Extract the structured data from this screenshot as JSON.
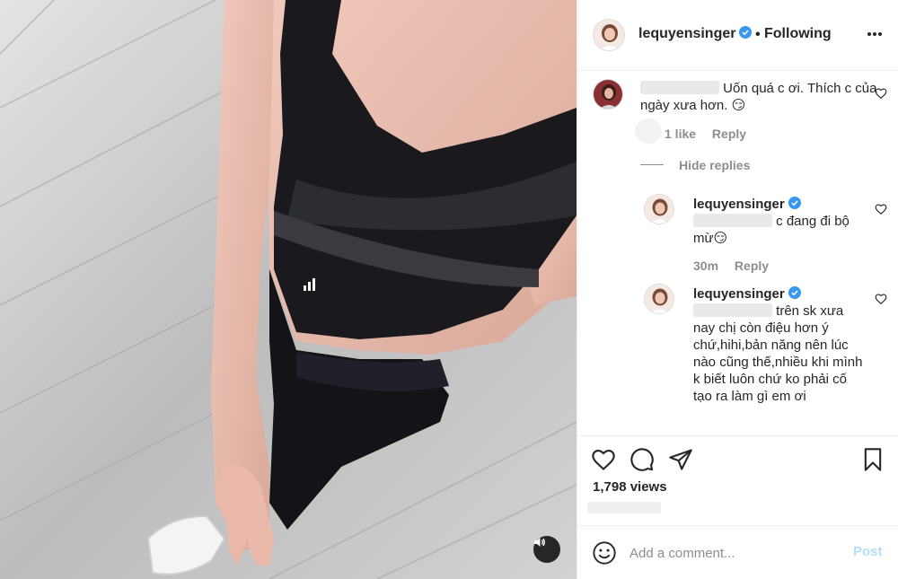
{
  "post": {
    "author": "lequyensinger",
    "verified": true,
    "follow_status": "Following",
    "separator": "•"
  },
  "comments": [
    {
      "id": "c1",
      "username": "",
      "text": "Uốn quá c ơi. Thích c của ngày xưa hơn. 😏",
      "likes_text": "1 like",
      "reply_label": "Reply",
      "hide_replies_label": "Hide replies",
      "replies": [
        {
          "id": "r1",
          "username": "lequyensinger",
          "verified": true,
          "text": "c đang đi bộ mừ😏",
          "time": "30m",
          "reply_label": "Reply"
        },
        {
          "id": "r2",
          "username": "lequyensinger",
          "verified": true,
          "text": "trên sk xưa nay chị còn điệu hơn ý chứ,hihi,bản năng nên lúc nào cũng thế,nhiều khi mình k biết luôn chứ ko phải cố tạo ra làm gì em ơi"
        }
      ]
    }
  ],
  "actions": {
    "like_icon": "heart-icon",
    "comment_icon": "comment-icon",
    "share_icon": "share-icon",
    "save_icon": "bookmark-icon"
  },
  "views_text": "1,798 views",
  "add_comment": {
    "placeholder": "Add a comment...",
    "post_label": "Post"
  },
  "colors": {
    "link_blue": "#0095f6",
    "post_disabled": "#b2dffc",
    "secondary_text": "#8e8e8e",
    "verified_blue": "#3897f0"
  }
}
